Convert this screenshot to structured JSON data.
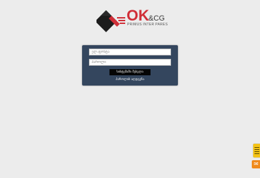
{
  "brand": {
    "logo_main": "OK",
    "logo_suffix": "&CG",
    "tagline": "PRIMUS INTER PARES",
    "colors": {
      "primary": "#d02f38",
      "dark": "#222222"
    }
  },
  "login": {
    "username_placeholder": "ელ.ფოსტა",
    "password_placeholder": "პაროლი",
    "submit_label": "სისტემაში შესვლა",
    "forgot_link": "პაროლის აღდგენა"
  },
  "widgets": {
    "help_icon": "document-icon",
    "chat_icon": "chat-icon"
  }
}
